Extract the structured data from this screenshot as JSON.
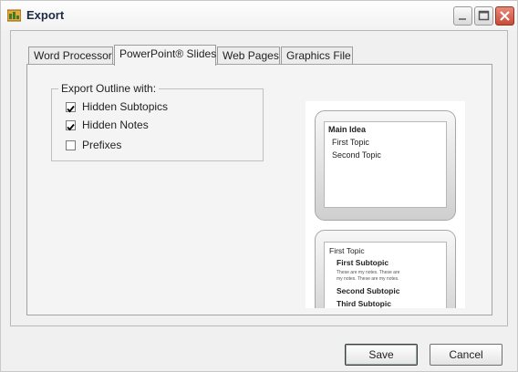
{
  "window": {
    "title": "Export"
  },
  "tabs": [
    {
      "label": "Word Processor"
    },
    {
      "label": "PowerPoint® Slides",
      "selected": true
    },
    {
      "label": "Web Pages"
    },
    {
      "label": "Graphics File"
    }
  ],
  "export_options": {
    "group_label": "Export Outline with:",
    "items": [
      {
        "label": "Hidden Subtopics",
        "checked": true
      },
      {
        "label": "Hidden Notes",
        "checked": true
      },
      {
        "label": "Prefixes",
        "checked": false
      }
    ]
  },
  "preview": {
    "slide1": {
      "title": "Main Idea",
      "topics": [
        "First Topic",
        "Second Topic"
      ]
    },
    "slide2": {
      "title": "First Topic",
      "subtopic1": "First Subtopic",
      "notes": [
        "These are my notes. These are",
        "my notes. These are my notes."
      ],
      "subtopic2": "Second Subtopic",
      "subtopic3": "Third Subtopic"
    }
  },
  "buttons": {
    "save": "Save",
    "cancel": "Cancel"
  },
  "colors": {
    "close_button": "#c94a38",
    "title_text": "#1c2a44"
  }
}
